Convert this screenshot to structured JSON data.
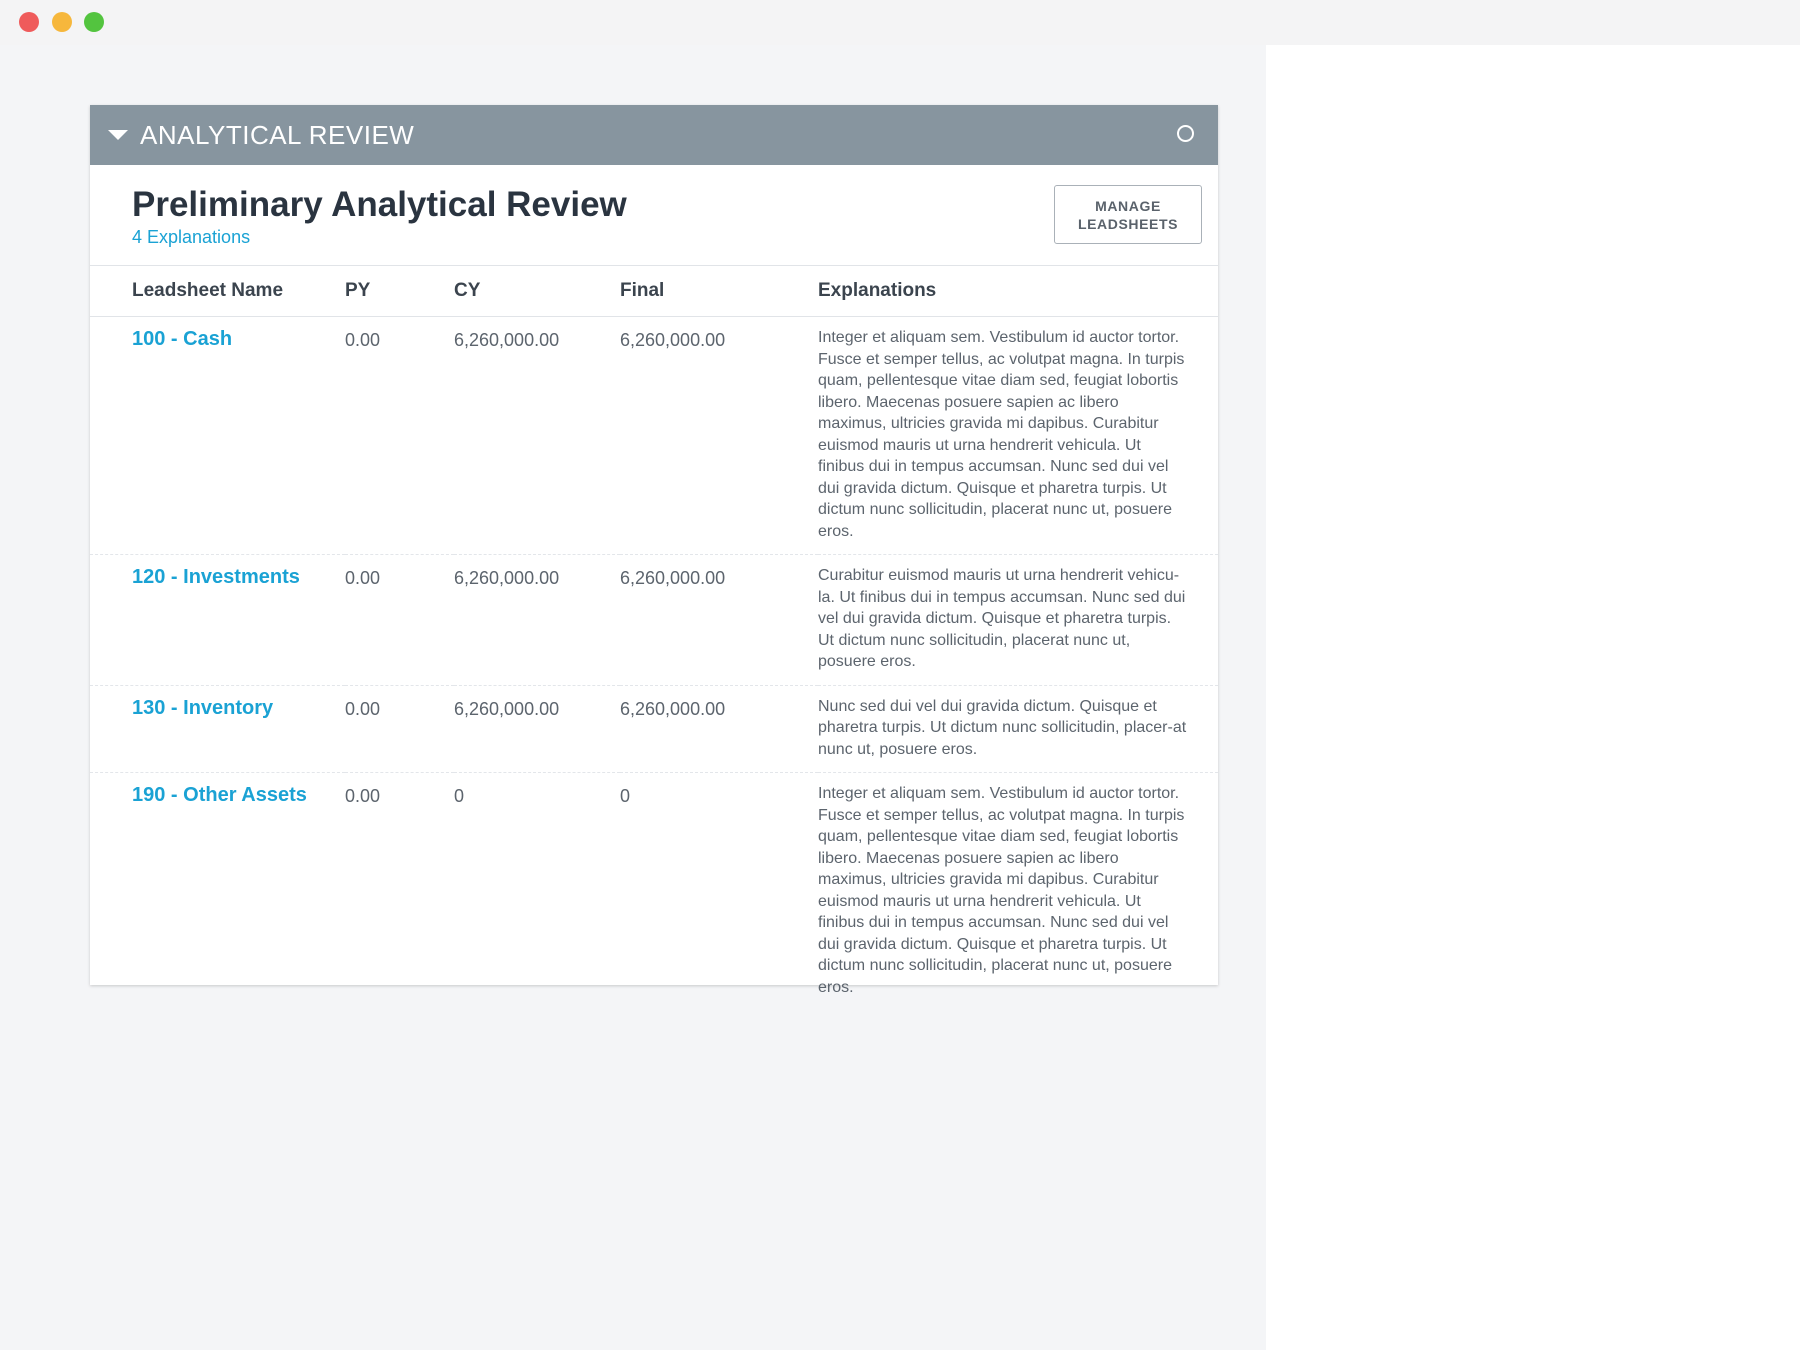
{
  "window": {
    "controls": [
      "close",
      "minimize",
      "zoom"
    ],
    "colors": {
      "close": "#ef5b5b",
      "minimize": "#f6b73c",
      "zoom": "#53c43f"
    }
  },
  "panel": {
    "header_title": "ANALYTICAL REVIEW",
    "header_color": "#87959f",
    "caret_icon": "caret-down-icon",
    "status_icon": "circle-outline-icon"
  },
  "review": {
    "title": "Preliminary Analytical Review",
    "subtitle": "4 Explanations",
    "manage_button_line1": "MANAGE",
    "manage_button_line2": "LEADSHEETS",
    "accent_color": "#1aa2d4"
  },
  "table": {
    "headers": {
      "name": "Leadsheet Name",
      "py": "PY",
      "cy": "CY",
      "final": "Final",
      "explanations": "Explanations"
    },
    "rows": [
      {
        "name": "100 - Cash",
        "py": "0.00",
        "cy": "6,260,000.00",
        "final": "6,260,000.00",
        "explanation": "Integer et aliquam sem. Vestibulum id auctor tortor. Fusce et semper tellus, ac volutpat magna. In turpis quam, pellentesque vitae diam sed, feugiat lobortis libero. Maecenas posuere sapien ac libero maximus, ultricies gravida mi dapibus. Curabitur euismod mauris ut urna hendrerit vehicula. Ut finibus dui in tempus accumsan. Nunc sed dui vel dui gravida dictum. Quisque et pharetra turpis. Ut dictum nunc sollicitudin, placerat nunc ut, posuere eros."
      },
      {
        "name": "120 - Investments",
        "py": "0.00",
        "cy": "6,260,000.00",
        "final": "6,260,000.00",
        "explanation": "Curabitur euismod mauris ut urna hendrerit vehicu-la. Ut finibus dui in tempus accumsan. Nunc sed dui vel dui gravida dictum. Quisque et pharetra turpis. Ut dictum nunc sollicitudin, placerat nunc ut, posuere eros."
      },
      {
        "name": "130 - Inventory",
        "py": "0.00",
        "cy": "6,260,000.00",
        "final": "6,260,000.00",
        "explanation": "Nunc sed dui vel dui gravida dictum. Quisque et pharetra turpis. Ut dictum nunc sollicitudin, placer-at nunc ut, posuere eros."
      },
      {
        "name": "190 - Other Assets",
        "py": "0.00",
        "cy": "0",
        "final": "0",
        "explanation": "Integer et aliquam sem. Vestibulum id auctor tortor. Fusce et semper tellus, ac volutpat magna. In turpis quam, pellentesque vitae diam sed, feugiat lobortis libero. Maecenas posuere sapien ac libero maximus, ultricies gravida mi dapibus. Curabitur euismod mauris ut urna hendrerit vehicula. Ut finibus dui in tempus accumsan. Nunc sed dui vel dui gravida dictum. Quisque et pharetra turpis. Ut dictum nunc sollicitudin, placerat nunc ut, posuere eros."
      }
    ]
  }
}
